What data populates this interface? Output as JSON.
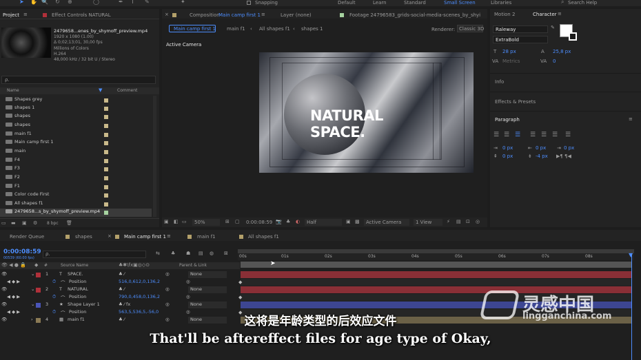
{
  "topbar": {
    "snapping": "Snapping",
    "workspaces": [
      "Default",
      "Learn",
      "Standard",
      "Small Screen",
      "Libraries"
    ],
    "active_workspace": "Small Screen",
    "search_help": "Search Help"
  },
  "project_panel": {
    "tab_project": "Project",
    "tab_effect_controls": "Effect Controls NATURAL",
    "file_name": "2479658...enes_by_shymoff_preview.mp4",
    "file_info": [
      "1920 x 1080 (1.00)",
      "Δ 0;02;13;01, 30,00 fps",
      "Millions of Colors",
      "H.264",
      "48,000 kHz / 32 bit U / Stereo"
    ],
    "search_placeholder": "ρ.",
    "col_name": "Name",
    "col_comment": "Comment",
    "items": [
      "Shapes grey",
      "shapes 1",
      "shapes",
      "shapes",
      "main f1",
      "Main camp first 1",
      "main",
      "F4",
      "F3",
      "F2",
      "F1",
      "Color code First",
      "All shapes f1",
      "2479658...s_by_shymoff_preview.mp4"
    ],
    "bpc": "8 bpc"
  },
  "comp_panel": {
    "tab_composition_prefix": "Composition",
    "tab_composition_name": "Main camp first 1",
    "tab_layer": "Layer (none)",
    "tab_footage": "Footage 24796583_grids-social-media-scenes_by_shyi",
    "breadcrumbs": [
      "Main camp first 1",
      "main f1",
      "All shapes f1",
      "shapes 1"
    ],
    "renderer_label": "Renderer:",
    "renderer_value": "Classic 3D",
    "active_camera": "Active Camera",
    "preview_title_line1": "NATURAL",
    "preview_title_line2": "SPACE.",
    "zoom": "50%",
    "timecode": "0:00:08:59",
    "resolution": "Half",
    "camera": "Active Camera",
    "view": "1 View"
  },
  "right_panel": {
    "tab_motion": "Motion 2",
    "tab_character": "Character",
    "font_family": "Raleway",
    "font_style": "ExtraBold",
    "font_size": "28 px",
    "leading": "25,8 px",
    "kerning": "Metrics",
    "tracking": "0",
    "info": "Info",
    "effects_presets": "Effects & Presets",
    "paragraph": "Paragraph",
    "indent_values": [
      "0 px",
      "0 px",
      "0 px",
      "0 px",
      "-4 px"
    ]
  },
  "timeline": {
    "tabs": [
      "Render Queue",
      "shapes",
      "Main camp first 1",
      "main f1",
      "All shapes f1"
    ],
    "active_tab": "Main camp first 1",
    "timecode": "0:00:08:59",
    "fps_note": "00539 (60.00 fps)",
    "col_source": "Source Name",
    "col_parent": "Parent & Link",
    "ruler": [
      "00s",
      "01s",
      "02s",
      "03s",
      "04s",
      "05s",
      "06s",
      "07s",
      "08s"
    ],
    "layers": [
      {
        "num": "1",
        "type": "T",
        "name": "SPACE.",
        "parent": "None",
        "position": "516,0,612,0,136,2"
      },
      {
        "num": "2",
        "type": "T",
        "name": "NATURAL",
        "parent": "None",
        "position": "790,0,458,0,136,2"
      },
      {
        "num": "3",
        "type": "★",
        "name": "Shape Layer 1",
        "parent": "None",
        "position": "563,5,536,5,-56,0"
      },
      {
        "num": "4",
        "type": "▦",
        "name": "main f1",
        "parent": "None"
      }
    ],
    "position_label": "Position",
    "layer_colors": [
      "#b0303a",
      "#b0303a",
      "#4a55b8",
      "#8a7a55"
    ]
  },
  "subtitle": {
    "cn": "这将是年龄类型的后效应文件",
    "en": "That'll be aftereffect files for age type of Okay,"
  },
  "watermark": {
    "cn": "灵感中国",
    "url": "lingganchina.com"
  }
}
